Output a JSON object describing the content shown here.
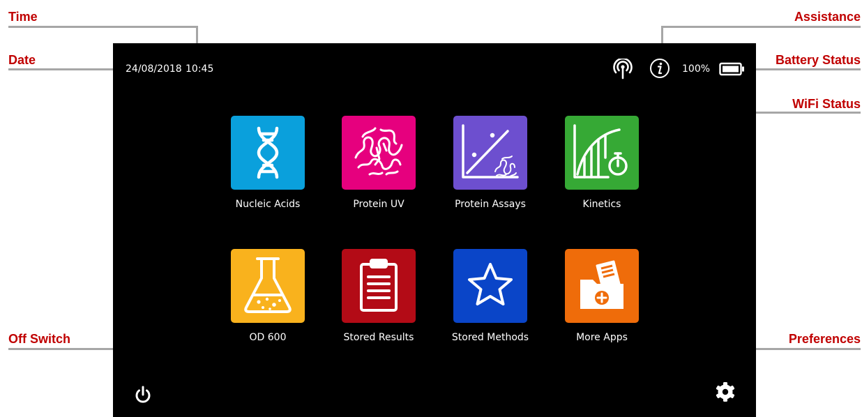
{
  "callouts": {
    "time": "Time",
    "date": "Date",
    "assistance": "Assistance",
    "battery_status": "Battery Status",
    "wifi_status": "WiFi Status",
    "off_switch": "Off Switch",
    "preferences": "Preferences"
  },
  "status_bar": {
    "date": "24/08/2018",
    "time": "10:45",
    "battery_percent_text": "100%",
    "battery_level": 1.0,
    "icons": [
      "wifi-icon",
      "info-icon",
      "battery-icon"
    ]
  },
  "apps": [
    {
      "label": "Nucleic Acids",
      "color": "#0aa0dc",
      "icon": "dna-icon"
    },
    {
      "label": "Protein UV",
      "color": "#e6007e",
      "icon": "protein-icon"
    },
    {
      "label": "Protein Assays",
      "color": "#6d4fcf",
      "icon": "protein-assay-icon"
    },
    {
      "label": "Kinetics",
      "color": "#36a935",
      "icon": "kinetics-icon"
    },
    {
      "label": "OD 600",
      "color": "#f9b21d",
      "icon": "flask-icon"
    },
    {
      "label": "Stored Results",
      "color": "#b30b16",
      "icon": "clipboard-icon"
    },
    {
      "label": "Stored Methods",
      "color": "#0a45c8",
      "icon": "star-icon"
    },
    {
      "label": "More Apps",
      "color": "#ef6c0a",
      "icon": "folder-add-icon"
    }
  ],
  "bottom_bar": {
    "icons": [
      "power-icon",
      "gear-icon"
    ]
  },
  "colors": {
    "screen_background": "#000000",
    "callout_text": "#c00000",
    "leader_line": "#a6a6a6"
  }
}
